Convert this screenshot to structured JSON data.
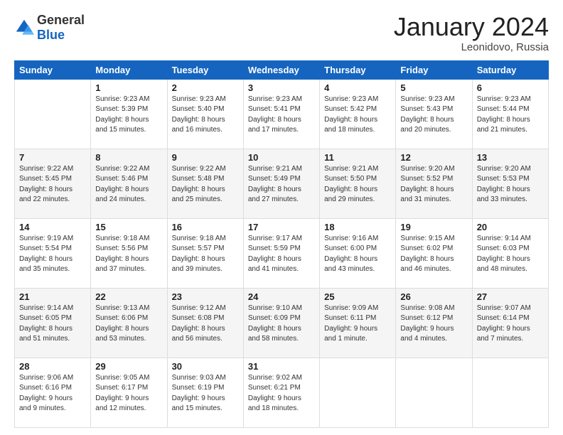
{
  "header": {
    "logo": {
      "general": "General",
      "blue": "Blue"
    },
    "title": "January 2024",
    "location": "Leonidovo, Russia"
  },
  "days_of_week": [
    "Sunday",
    "Monday",
    "Tuesday",
    "Wednesday",
    "Thursday",
    "Friday",
    "Saturday"
  ],
  "weeks": [
    [
      {
        "day": "",
        "info": ""
      },
      {
        "day": "1",
        "info": "Sunrise: 9:23 AM\nSunset: 5:39 PM\nDaylight: 8 hours and 15 minutes."
      },
      {
        "day": "2",
        "info": "Sunrise: 9:23 AM\nSunset: 5:40 PM\nDaylight: 8 hours and 16 minutes."
      },
      {
        "day": "3",
        "info": "Sunrise: 9:23 AM\nSunset: 5:41 PM\nDaylight: 8 hours and 17 minutes."
      },
      {
        "day": "4",
        "info": "Sunrise: 9:23 AM\nSunset: 5:42 PM\nDaylight: 8 hours and 18 minutes."
      },
      {
        "day": "5",
        "info": "Sunrise: 9:23 AM\nSunset: 5:43 PM\nDaylight: 8 hours and 20 minutes."
      },
      {
        "day": "6",
        "info": "Sunrise: 9:23 AM\nSunset: 5:44 PM\nDaylight: 8 hours and 21 minutes."
      }
    ],
    [
      {
        "day": "7",
        "info": "Sunrise: 9:22 AM\nSunset: 5:45 PM\nDaylight: 8 hours and 22 minutes."
      },
      {
        "day": "8",
        "info": "Sunrise: 9:22 AM\nSunset: 5:46 PM\nDaylight: 8 hours and 24 minutes."
      },
      {
        "day": "9",
        "info": "Sunrise: 9:22 AM\nSunset: 5:48 PM\nDaylight: 8 hours and 25 minutes."
      },
      {
        "day": "10",
        "info": "Sunrise: 9:21 AM\nSunset: 5:49 PM\nDaylight: 8 hours and 27 minutes."
      },
      {
        "day": "11",
        "info": "Sunrise: 9:21 AM\nSunset: 5:50 PM\nDaylight: 8 hours and 29 minutes."
      },
      {
        "day": "12",
        "info": "Sunrise: 9:20 AM\nSunset: 5:52 PM\nDaylight: 8 hours and 31 minutes."
      },
      {
        "day": "13",
        "info": "Sunrise: 9:20 AM\nSunset: 5:53 PM\nDaylight: 8 hours and 33 minutes."
      }
    ],
    [
      {
        "day": "14",
        "info": "Sunrise: 9:19 AM\nSunset: 5:54 PM\nDaylight: 8 hours and 35 minutes."
      },
      {
        "day": "15",
        "info": "Sunrise: 9:18 AM\nSunset: 5:56 PM\nDaylight: 8 hours and 37 minutes."
      },
      {
        "day": "16",
        "info": "Sunrise: 9:18 AM\nSunset: 5:57 PM\nDaylight: 8 hours and 39 minutes."
      },
      {
        "day": "17",
        "info": "Sunrise: 9:17 AM\nSunset: 5:59 PM\nDaylight: 8 hours and 41 minutes."
      },
      {
        "day": "18",
        "info": "Sunrise: 9:16 AM\nSunset: 6:00 PM\nDaylight: 8 hours and 43 minutes."
      },
      {
        "day": "19",
        "info": "Sunrise: 9:15 AM\nSunset: 6:02 PM\nDaylight: 8 hours and 46 minutes."
      },
      {
        "day": "20",
        "info": "Sunrise: 9:14 AM\nSunset: 6:03 PM\nDaylight: 8 hours and 48 minutes."
      }
    ],
    [
      {
        "day": "21",
        "info": "Sunrise: 9:14 AM\nSunset: 6:05 PM\nDaylight: 8 hours and 51 minutes."
      },
      {
        "day": "22",
        "info": "Sunrise: 9:13 AM\nSunset: 6:06 PM\nDaylight: 8 hours and 53 minutes."
      },
      {
        "day": "23",
        "info": "Sunrise: 9:12 AM\nSunset: 6:08 PM\nDaylight: 8 hours and 56 minutes."
      },
      {
        "day": "24",
        "info": "Sunrise: 9:10 AM\nSunset: 6:09 PM\nDaylight: 8 hours and 58 minutes."
      },
      {
        "day": "25",
        "info": "Sunrise: 9:09 AM\nSunset: 6:11 PM\nDaylight: 9 hours and 1 minute."
      },
      {
        "day": "26",
        "info": "Sunrise: 9:08 AM\nSunset: 6:12 PM\nDaylight: 9 hours and 4 minutes."
      },
      {
        "day": "27",
        "info": "Sunrise: 9:07 AM\nSunset: 6:14 PM\nDaylight: 9 hours and 7 minutes."
      }
    ],
    [
      {
        "day": "28",
        "info": "Sunrise: 9:06 AM\nSunset: 6:16 PM\nDaylight: 9 hours and 9 minutes."
      },
      {
        "day": "29",
        "info": "Sunrise: 9:05 AM\nSunset: 6:17 PM\nDaylight: 9 hours and 12 minutes."
      },
      {
        "day": "30",
        "info": "Sunrise: 9:03 AM\nSunset: 6:19 PM\nDaylight: 9 hours and 15 minutes."
      },
      {
        "day": "31",
        "info": "Sunrise: 9:02 AM\nSunset: 6:21 PM\nDaylight: 9 hours and 18 minutes."
      },
      {
        "day": "",
        "info": ""
      },
      {
        "day": "",
        "info": ""
      },
      {
        "day": "",
        "info": ""
      }
    ]
  ]
}
